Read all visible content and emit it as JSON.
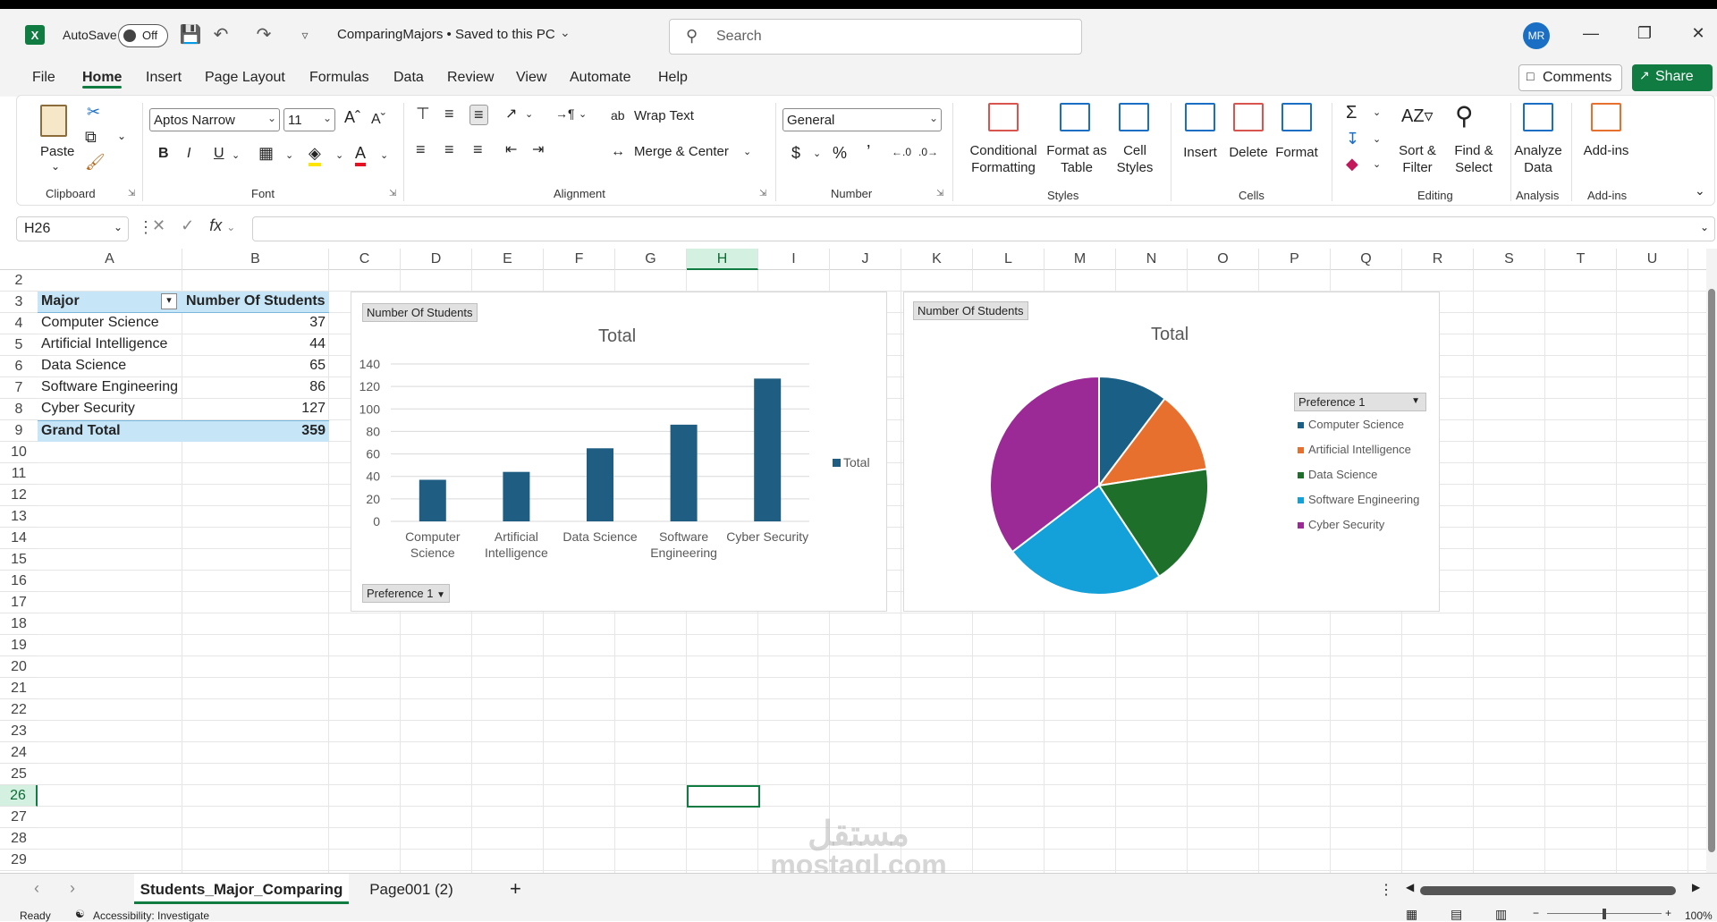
{
  "titlebar": {
    "logo": "X",
    "autosave_label": "AutoSave",
    "autosave_state": "Off",
    "doc_title": "ComparingMajors • Saved to this PC",
    "search_placeholder": "Search",
    "avatar_initials": "MR"
  },
  "menu": [
    "File",
    "Home",
    "Insert",
    "Page Layout",
    "Formulas",
    "Data",
    "Review",
    "View",
    "Automate",
    "Help"
  ],
  "menu_active": "Home",
  "comments_label": "Comments",
  "share_label": "Share",
  "ribbon": {
    "paste": "Paste",
    "clipboard": "Clipboard",
    "font_name": "Aptos Narrow",
    "font_size": "11",
    "font": "Font",
    "wrap_text": "Wrap Text",
    "merge_center": "Merge & Center",
    "alignment": "Alignment",
    "number_format": "General",
    "number": "Number",
    "conditional_1": "Conditional",
    "conditional_2": "Formatting",
    "format_table_1": "Format as",
    "format_table_2": "Table",
    "cell_styles_1": "Cell",
    "cell_styles_2": "Styles",
    "styles": "Styles",
    "insert": "Insert",
    "delete": "Delete",
    "format": "Format",
    "cells": "Cells",
    "sort_1": "Sort &",
    "sort_2": "Filter",
    "find_1": "Find &",
    "find_2": "Select",
    "editing": "Editing",
    "analyze_1": "Analyze",
    "analyze_2": "Data",
    "analysis": "Analysis",
    "addins": "Add-ins",
    "addins_group": "Add-ins"
  },
  "namebox": "H26",
  "fx": "fx",
  "columns": [
    "A",
    "B",
    "C",
    "D",
    "E",
    "F",
    "G",
    "H",
    "I",
    "J",
    "K",
    "L",
    "M",
    "N",
    "O",
    "P",
    "Q",
    "R",
    "S",
    "T",
    "U"
  ],
  "selected_column": "H",
  "rows": [
    "2",
    "3",
    "4",
    "5",
    "6",
    "7",
    "8",
    "9",
    "10",
    "11",
    "12",
    "13",
    "14",
    "15",
    "16",
    "17",
    "18",
    "19",
    "20",
    "21",
    "22",
    "23",
    "24",
    "25",
    "26",
    "27",
    "28",
    "29"
  ],
  "selected_row": "26",
  "pivot": {
    "header_major": "Major",
    "header_count": "Number Of Students",
    "rows": [
      {
        "major": "Computer Science",
        "count": "37"
      },
      {
        "major": "Artificial Intelligence",
        "count": "44"
      },
      {
        "major": "Data Science",
        "count": "65"
      },
      {
        "major": "Software Engineering",
        "count": "86"
      },
      {
        "major": "Cyber Security",
        "count": "127"
      }
    ],
    "total_label": "Grand Total",
    "total_value": "359"
  },
  "bar_chart": {
    "field_button": "Number  Of  Students",
    "title": "Total",
    "legend": "Total",
    "filter_button": "Preference 1",
    "y_ticks": [
      "0",
      "20",
      "40",
      "60",
      "80",
      "100",
      "120",
      "140"
    ]
  },
  "pie_chart": {
    "field_button": "Number  Of  Students",
    "title": "Total",
    "legend_button": "Preference 1"
  },
  "chart_data": [
    {
      "type": "bar",
      "title": "Total",
      "categories": [
        "Computer Science",
        "Artificial Intelligence",
        "Data Science",
        "Software Engineering",
        "Cyber Security"
      ],
      "series": [
        {
          "name": "Total",
          "values": [
            37,
            44,
            65,
            86,
            127
          ],
          "color": "#1f5e82"
        }
      ],
      "ylim": [
        0,
        140
      ],
      "grid": true,
      "legend": "right"
    },
    {
      "type": "pie",
      "title": "Total",
      "labels": [
        "Computer Science",
        "Artificial Intelligence",
        "Data Science",
        "Software Engineering",
        "Cyber Security"
      ],
      "values": [
        37,
        44,
        65,
        86,
        127
      ],
      "colors": [
        "#1a5f86",
        "#e8702e",
        "#1e6f2a",
        "#14a0d8",
        "#9b2a96"
      ],
      "legend": "right"
    }
  ],
  "sheet_tabs": [
    "Students_Major_Comparing",
    "Page001 (2)"
  ],
  "active_tab": "Students_Major_Comparing",
  "status": {
    "ready": "Ready",
    "accessibility": "Accessibility: Investigate",
    "zoom": "100%"
  },
  "watermark_1": "مستقل",
  "watermark_2": "mostaql.com"
}
